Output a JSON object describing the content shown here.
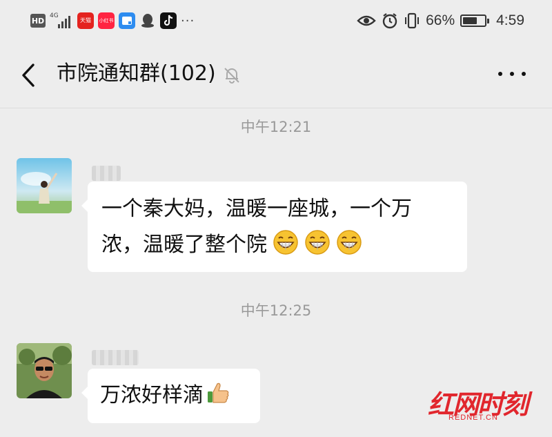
{
  "status_bar": {
    "hd": "HD",
    "network": "4G",
    "apps": [
      {
        "name": "tmall-app-icon",
        "label": "天猫"
      },
      {
        "name": "xiaohongshu-app-icon",
        "label": "小红书"
      },
      {
        "name": "blue-app-icon",
        "label": ""
      },
      {
        "name": "qq-app-icon",
        "label": ""
      },
      {
        "name": "tiktok-app-icon",
        "label": ""
      }
    ],
    "overflow": "···",
    "battery_pct_text": "66%",
    "battery_level": 0.66,
    "time": "4:59"
  },
  "header": {
    "title": "市院通知群(102)"
  },
  "messages": [
    {
      "timestamp": "中午12:21",
      "text_line1": "一个秦大妈，温暖一座城，一个万",
      "text_line2": "浓，温暖了整个院",
      "emoji": "grinning-face-emoji"
    },
    {
      "timestamp": "中午12:25",
      "text": "万浓好样滴",
      "emoji": "thumbs-up-emoji"
    }
  ],
  "watermark": {
    "logo_text": "红网时刻",
    "site": "REDNET.CN"
  },
  "colors": {
    "background": "#ededed",
    "bubble": "#ffffff",
    "timestamp": "#999999",
    "brand_red": "#e1262d"
  }
}
